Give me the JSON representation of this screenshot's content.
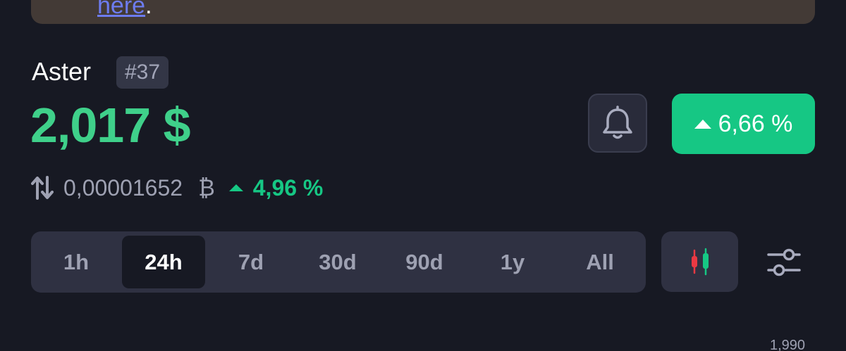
{
  "banner": {
    "link_text": "here",
    "trailing": "."
  },
  "coin": {
    "name": "Aster",
    "rank": "#37",
    "price": "2,017 $",
    "change_24h": "6,66 %",
    "change_direction": "up"
  },
  "btc": {
    "value": "0,00001652",
    "symbol": "₿",
    "change": "4,96 %",
    "change_direction": "up"
  },
  "timeframes": {
    "options": [
      "1h",
      "24h",
      "7d",
      "30d",
      "90d",
      "1y",
      "All"
    ],
    "selected": "24h"
  },
  "chart": {
    "axis_top_label": "1,990"
  },
  "icons": {
    "alert": "bell-icon",
    "swap": "swap-arrows-icon",
    "chart_type": "candlestick-icon",
    "settings": "sliders-icon"
  },
  "colors": {
    "background": "#171923",
    "positive": "#16c784",
    "price": "#3fd08a",
    "banner": "#433a36",
    "link": "#6d7cf0",
    "panel": "#2f3142",
    "candle_red": "#ea3943",
    "candle_green": "#16c784"
  }
}
